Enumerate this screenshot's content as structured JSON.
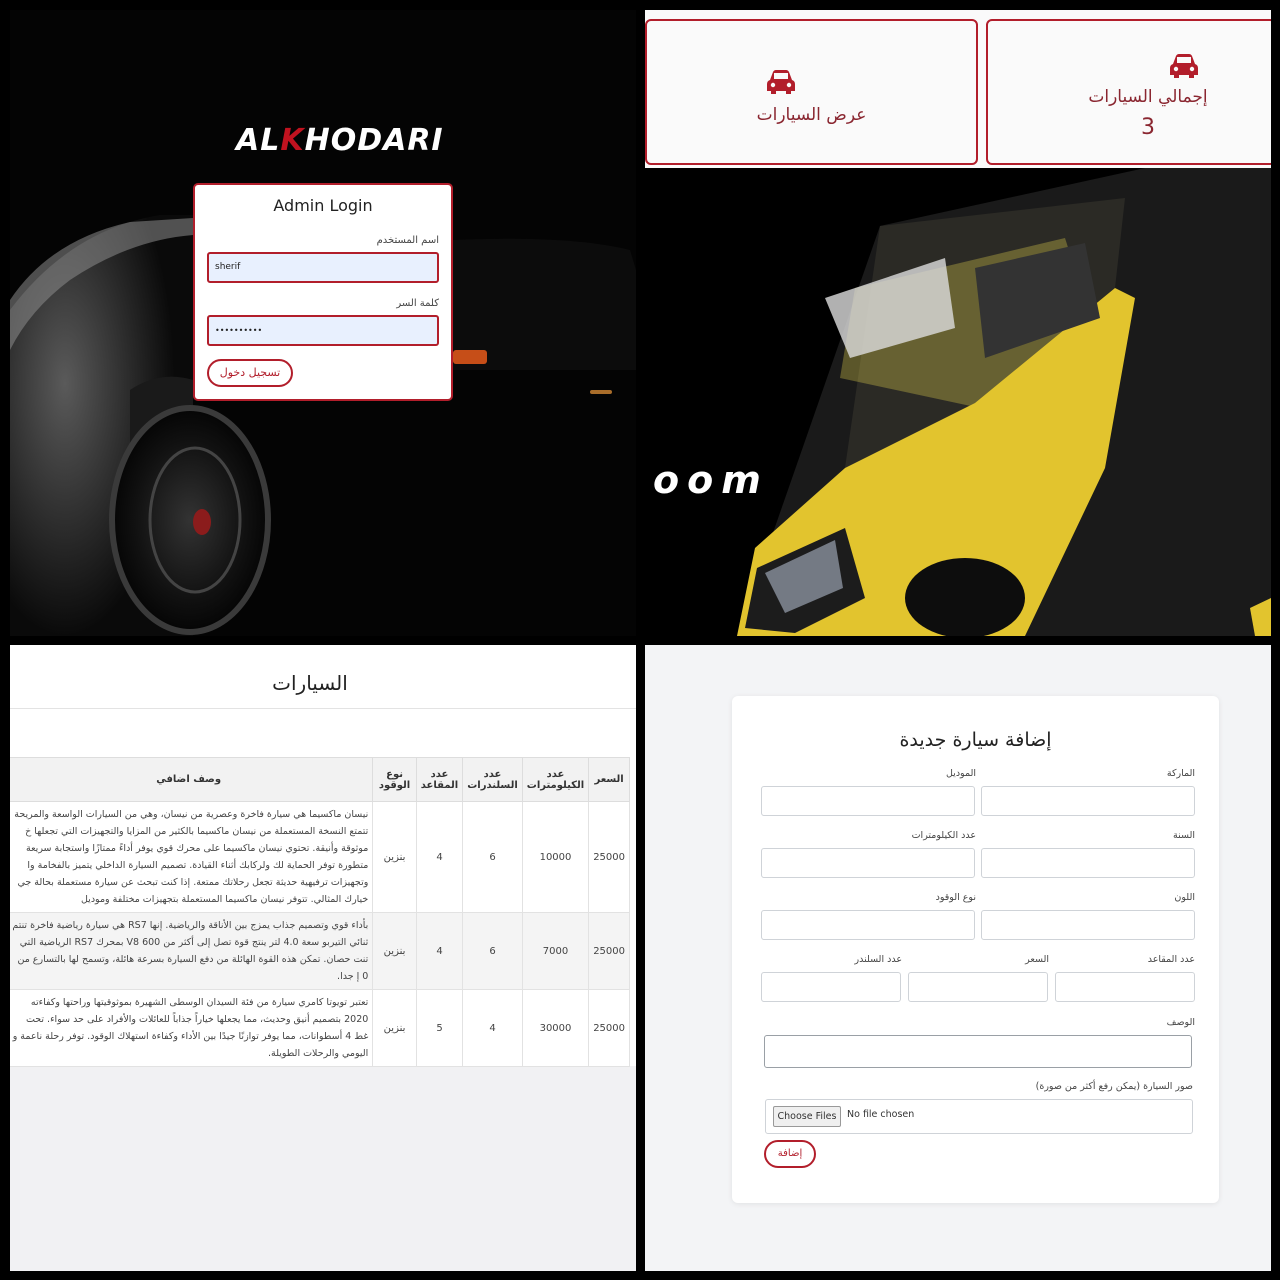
{
  "login": {
    "logo": {
      "prefix": "AL",
      "accent": "K",
      "suffix": "HODARI"
    },
    "title": "Admin Login",
    "username_label": "اسم المستخدم",
    "username_value": "sherif",
    "password_label": "كلمة السر",
    "password_value": "••••••••••",
    "submit_label": "تسجيل دخول"
  },
  "dashboard": {
    "total_cars_label": "إجمالي السيارات",
    "total_cars_value": "3",
    "view_cars_label": "عرض السيارات",
    "hero_text": "oom"
  },
  "cars_table": {
    "title": "السيارات",
    "headers": {
      "description": "وصف اضافي",
      "fuel": "نوع الوقود",
      "seats": "عدد المقاعد",
      "cylinders": "عدد السلندرات",
      "km": "عدد الكيلومترات",
      "price": "السعر"
    },
    "rows": [
      {
        "description": "نيسان ماكسيما هي سيارة فاخرة وعصرية من نيسان، وهي من السيارات الواسعة والمريحة تتمتع النسخة المستعملة من نيسان ماكسيما بالكثير من المزايا والتجهيزات التي تجعلها خ موثوقة وأنيقة. تحتوي نيسان ماكسيما على محرك قوي يوفر أداءً ممتازًا واستجابة سريعة متطورة توفر الحماية لك ولركابك أثناء القيادة. تصميم السيارة الداخلي يتميز بالفخامة وا وتجهيزات ترفيهية حديثة تجعل رحلاتك ممتعة. إذا كنت تبحث عن سيارة مستعملة بحالة جي خيارك المثالي. تتوفر نيسان ماكسيما المستعملة بتجهيزات مختلفة وموديل",
        "fuel": "بنزين",
        "seats": "4",
        "cylinders": "6",
        "km": "10000",
        "price": "25000"
      },
      {
        "description": "بأداء قوي وتصميم جذاب يمزج بين الأناقة والرياضية. إنها RS7 هي سيارة رياضية فاخرة تنتم ثنائي التيربو سعة 4.0 لتر ينتج قوة تصل إلى أكثر من 600 V8 بمحرك RS7 الرياضية التي تنت حصان. تمكن هذه القوة الهائلة من دفع السيارة بسرعة هائلة، وتسمح لها بالتسارع من 0 إ جدا.",
        "fuel": "بنزين",
        "seats": "4",
        "cylinders": "6",
        "km": "7000",
        "price": "25000"
      },
      {
        "description": "تعتبر تويوتا كامري سيارة من فئة السيدان الوسطى الشهيرة بموثوقيتها وراحتها وكفاءته 2020 بتصميم أنيق وحديث، مما يجعلها خياراً جذاباً للعائلات والأفراد على حد سواء. تحت غط 4 أسطوانات، مما يوفر توازنًا جيدًا بين الأداء وكفاءة استهلاك الوقود. توفر رحلة ناعمة و اليومي والرحلات الطويلة.",
        "fuel": "بنزين",
        "seats": "5",
        "cylinders": "4",
        "km": "30000",
        "price": "25000"
      }
    ]
  },
  "add_car_form": {
    "title": "إضافة سيارة جديدة",
    "brand_label": "الماركة",
    "model_label": "الموديل",
    "year_label": "السنة",
    "km_label": "عدد الكيلومترات",
    "color_label": "اللون",
    "fuel_label": "نوع الوقود",
    "seats_label": "عدد المقاعد",
    "price_label": "السعر",
    "cylinders_label": "عدد السلندر",
    "description_label": "الوصف",
    "images_label": "صور السيارة (يمكن رفع أكثر من صورة)",
    "choose_files_label": "Choose Files",
    "no_file_label": "No file chosen",
    "submit_label": "إضافة"
  },
  "colors": {
    "accent": "#b21e2b",
    "label_dark_red": "#8a2630",
    "car_yellow": "#e2c42e"
  }
}
